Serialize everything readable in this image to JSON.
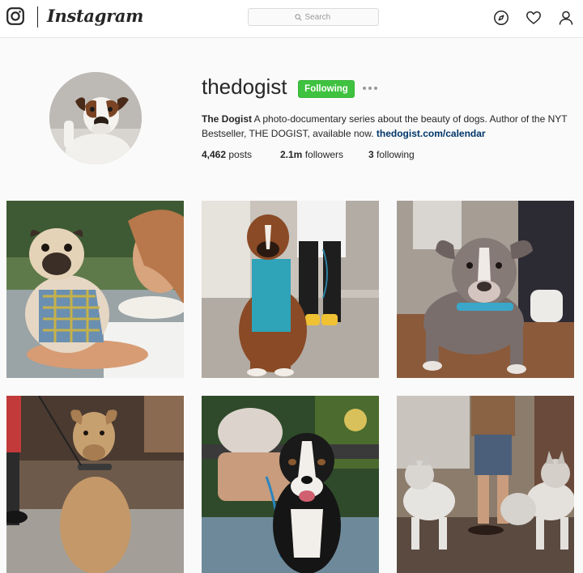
{
  "header": {
    "wordmark": "Instagram",
    "search_placeholder": "Search",
    "icons": [
      "camera-logo-icon",
      "search-icon",
      "compass-icon",
      "heart-icon",
      "person-icon"
    ]
  },
  "profile": {
    "username": "thedogist",
    "follow_label": "Following",
    "bio_name": "The Dogist",
    "bio_text": "A photo-documentary series about the beauty of dogs. Author of the NYT Bestseller, THE DOGIST, available now.",
    "bio_link": "thedogist.com/calendar",
    "stats": {
      "posts_count": "4,462",
      "posts_label": "posts",
      "followers_count": "2.1m",
      "followers_label": "followers",
      "following_count": "3",
      "following_label": "following"
    }
  },
  "colors": {
    "following_green": "#3fc23f",
    "link": "#003569",
    "text": "#262626",
    "background": "#fafafa"
  }
}
